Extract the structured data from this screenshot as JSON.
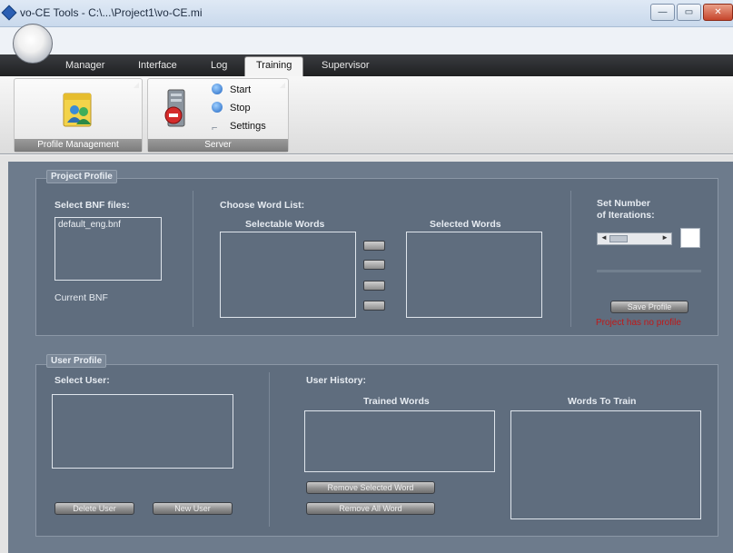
{
  "window": {
    "title": "vo-CE Tools - C:\\...\\Project1\\vo-CE.mi",
    "minimize_glyph": "—",
    "maximize_glyph": "▭",
    "close_glyph": "✕"
  },
  "tabs": [
    "Manager",
    "Interface",
    "Log",
    "Training",
    "Supervisor"
  ],
  "active_tab": "Training",
  "ribbon": {
    "profile_management": {
      "label": "Profile Management",
      "icon": "users-icon"
    },
    "server": {
      "label": "Server",
      "items": [
        {
          "label": "Start",
          "icon": "start-icon"
        },
        {
          "label": "Stop",
          "icon": "stop-icon"
        },
        {
          "label": "Settings",
          "icon": "settings-icon"
        }
      ]
    }
  },
  "project_profile": {
    "title": "Project Profile",
    "select_bnf_label": "Select BNF files:",
    "bnf_files": [
      "default_eng.bnf"
    ],
    "current_bnf_label": "Current BNF",
    "choose_word_list_label": "Choose Word List:",
    "selectable_words_label": "Selectable Words",
    "selected_words_label": "Selected Words",
    "set_iterations_label_line1": "Set Number",
    "set_iterations_label_line2": "of Iterations:",
    "save_profile_label": "Save Profile",
    "status_message": "Project has no profile",
    "colors": {
      "status": "#c01818"
    }
  },
  "user_profile": {
    "title": "User Profile",
    "select_user_label": "Select User:",
    "delete_user_label": "Delete User",
    "new_user_label": "New User",
    "user_history_label": "User History:",
    "trained_words_label": "Trained Words",
    "words_to_train_label": "Words To Train",
    "remove_selected_label": "Remove Selected Word",
    "remove_all_label": "Remove All Word"
  }
}
